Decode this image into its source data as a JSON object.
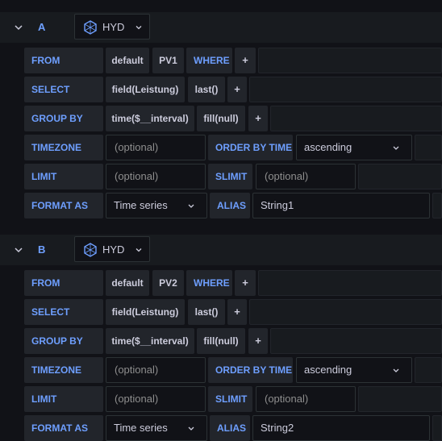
{
  "queries": [
    {
      "ref_id": "A",
      "datasource": "HYD",
      "from": {
        "label": "FROM",
        "policy": "default",
        "measurement": "PV1",
        "where_label": "WHERE",
        "add": "+"
      },
      "select": {
        "label": "SELECT",
        "field": "field(Leistung)",
        "fn": "last()",
        "add": "+"
      },
      "group_by": {
        "label": "GROUP BY",
        "time": "time($__interval)",
        "fill": "fill(null)",
        "add": "+"
      },
      "timezone": {
        "label": "TIMEZONE",
        "placeholder": "(optional)",
        "order_label": "ORDER BY TIME",
        "order_value": "ascending"
      },
      "limit": {
        "label": "LIMIT",
        "placeholder": "(optional)",
        "slimit_label": "SLIMIT",
        "slimit_placeholder": "(optional)"
      },
      "format": {
        "label": "FORMAT AS",
        "value": "Time series",
        "alias_label": "ALIAS",
        "alias_value": "String1"
      }
    },
    {
      "ref_id": "B",
      "datasource": "HYD",
      "from": {
        "label": "FROM",
        "policy": "default",
        "measurement": "PV2",
        "where_label": "WHERE",
        "add": "+"
      },
      "select": {
        "label": "SELECT",
        "field": "field(Leistung)",
        "fn": "last()",
        "add": "+"
      },
      "group_by": {
        "label": "GROUP BY",
        "time": "time($__interval)",
        "fill": "fill(null)",
        "add": "+"
      },
      "timezone": {
        "label": "TIMEZONE",
        "placeholder": "(optional)",
        "order_label": "ORDER BY TIME",
        "order_value": "ascending"
      },
      "limit": {
        "label": "LIMIT",
        "placeholder": "(optional)",
        "slimit_label": "SLIMIT",
        "slimit_placeholder": "(optional)"
      },
      "format": {
        "label": "FORMAT AS",
        "value": "Time series",
        "alias_label": "ALIAS",
        "alias_value": "String2"
      }
    }
  ],
  "icons": {
    "collapse": "chevron-down-icon",
    "datasource": "influxdb-icon",
    "dropdown": "chevron-down-icon"
  },
  "colors": {
    "keyword": "#6e9fff",
    "background": "#111217",
    "segment": "#22252b"
  }
}
